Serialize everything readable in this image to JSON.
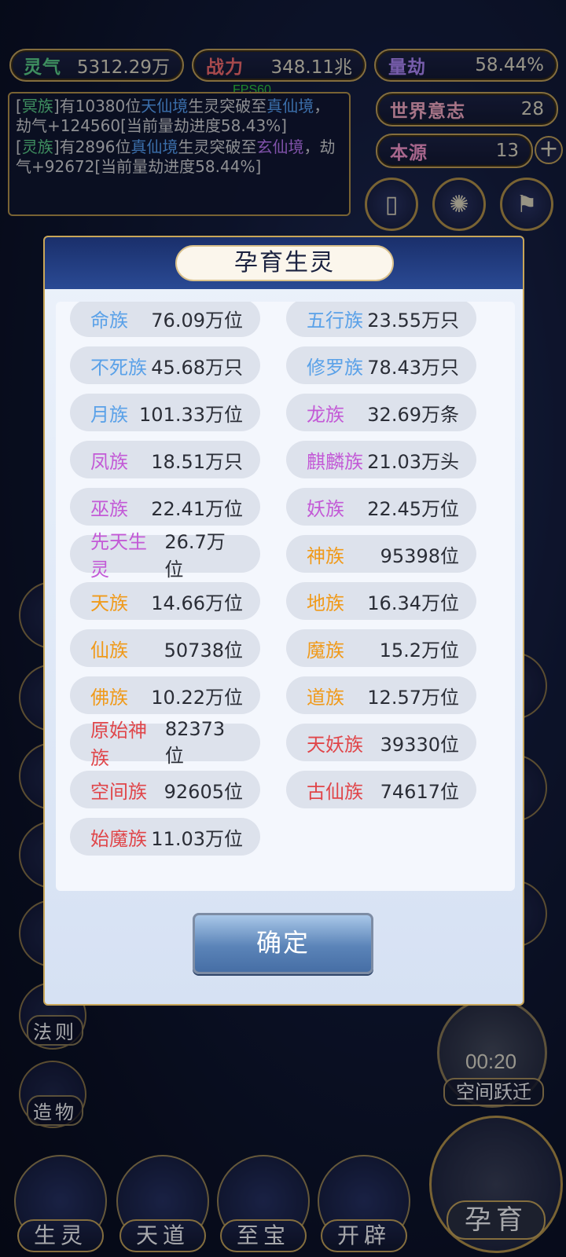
{
  "header": {
    "stats": [
      {
        "key": "灵气",
        "value": "5312.29万",
        "color": "#5fd88a"
      },
      {
        "key": "战力",
        "value": "348.11兆",
        "color": "#ff6e6e"
      },
      {
        "key": "量劫",
        "value": "58.44%",
        "color": "#b58cff"
      }
    ],
    "world_will": {
      "key": "世界意志",
      "value": "28"
    },
    "source": {
      "key": "本源",
      "value": "13"
    },
    "plus_icon": "plus-icon",
    "fps": "FPS60"
  },
  "log": {
    "entries": [
      {
        "parts": [
          {
            "t": "[",
            "c": "#d9d9d9"
          },
          {
            "t": "冥族",
            "c": "#5fd88a"
          },
          {
            "t": "]有10380位",
            "c": "#d9d9d9"
          },
          {
            "t": "天仙境",
            "c": "#5aa8ff"
          },
          {
            "t": "生灵突破至",
            "c": "#d9d9d9"
          },
          {
            "t": "真仙境",
            "c": "#5aa8ff"
          },
          {
            "t": "，劫气+124560[当前量劫进度58.43%]",
            "c": "#d9d9d9"
          }
        ]
      },
      {
        "parts": [
          {
            "t": "[",
            "c": "#d9d9d9"
          },
          {
            "t": "灵族",
            "c": "#5fd88a"
          },
          {
            "t": "]有2896位",
            "c": "#d9d9d9"
          },
          {
            "t": "真仙境",
            "c": "#5aa8ff"
          },
          {
            "t": "生灵突破至",
            "c": "#d9d9d9"
          },
          {
            "t": "玄仙境",
            "c": "#c57cff"
          },
          {
            "t": "，劫气+92672[当前量劫进度58.44%]",
            "c": "#d9d9d9"
          }
        ]
      }
    ]
  },
  "modal": {
    "title": "孕育生灵",
    "confirm_label": "确定",
    "races": [
      {
        "name": "命族",
        "value": "76.09万位",
        "color": "#5aa1e8"
      },
      {
        "name": "五行族",
        "value": "23.55万只",
        "color": "#5aa1e8"
      },
      {
        "name": "不死族",
        "value": "45.68万只",
        "color": "#5aa1e8"
      },
      {
        "name": "修罗族",
        "value": "78.43万只",
        "color": "#5aa1e8"
      },
      {
        "name": "月族",
        "value": "101.33万位",
        "color": "#5aa1e8"
      },
      {
        "name": "龙族",
        "value": "32.69万条",
        "color": "#c35ad6"
      },
      {
        "name": "凤族",
        "value": "18.51万只",
        "color": "#c35ad6"
      },
      {
        "name": "麒麟族",
        "value": "21.03万头",
        "color": "#c35ad6"
      },
      {
        "name": "巫族",
        "value": "22.41万位",
        "color": "#c35ad6"
      },
      {
        "name": "妖族",
        "value": "22.45万位",
        "color": "#c35ad6"
      },
      {
        "name": "先天生灵",
        "value": "26.7万位",
        "color": "#c35ad6"
      },
      {
        "name": "神族",
        "value": "95398位",
        "color": "#f09a1a"
      },
      {
        "name": "天族",
        "value": "14.66万位",
        "color": "#f09a1a"
      },
      {
        "name": "地族",
        "value": "16.34万位",
        "color": "#f09a1a"
      },
      {
        "name": "仙族",
        "value": "50738位",
        "color": "#f09a1a"
      },
      {
        "name": "魔族",
        "value": "15.2万位",
        "color": "#f09a1a"
      },
      {
        "name": "佛族",
        "value": "10.22万位",
        "color": "#f09a1a"
      },
      {
        "name": "道族",
        "value": "12.57万位",
        "color": "#f09a1a"
      },
      {
        "name": "原始神族",
        "value": "82373位",
        "color": "#e0464a"
      },
      {
        "name": "天妖族",
        "value": "39330位",
        "color": "#e0464a"
      },
      {
        "name": "空间族",
        "value": "92605位",
        "color": "#e0464a"
      },
      {
        "name": "古仙族",
        "value": "74617位",
        "color": "#e0464a"
      },
      {
        "name": "始魔族",
        "value": "11.03万位",
        "color": "#e0464a"
      }
    ]
  },
  "side_buttons": {
    "law": "法则",
    "creation": "造物"
  },
  "timer": {
    "time": "00:20",
    "label": "空间跃迁"
  },
  "bottom_nav": [
    {
      "label": "生灵"
    },
    {
      "label": "天道"
    },
    {
      "label": "至宝"
    },
    {
      "label": "开辟"
    }
  ],
  "big_action": "孕育"
}
